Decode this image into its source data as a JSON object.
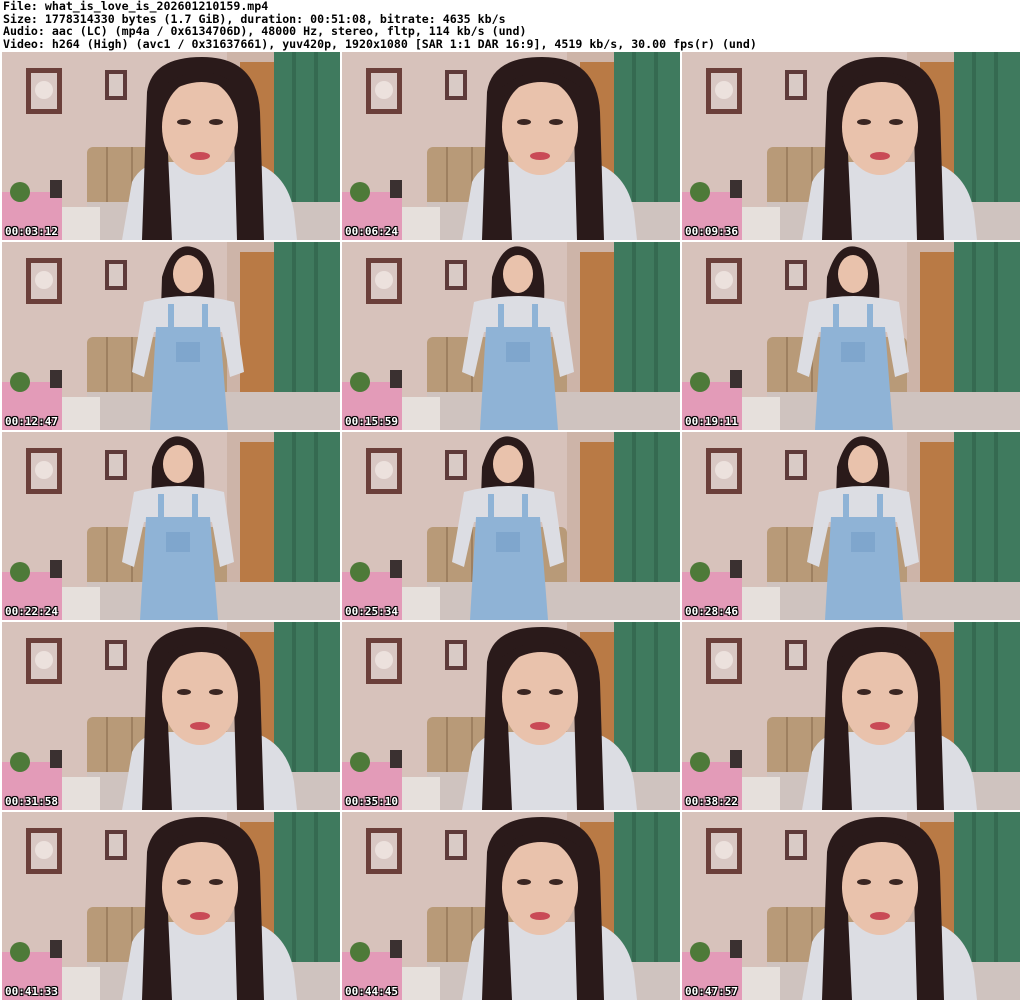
{
  "file_info": {
    "file": "File: what_is_love_is_202601210159.mp4",
    "size": "Size: 1778314330 bytes (1.7 GiB), duration: 00:51:08, bitrate: 4635 kb/s",
    "audio": "Audio: aac (LC) (mp4a / 0x6134706D), 48000 Hz, stereo, fltp, 114 kb/s (und)",
    "video": "Video: h264 (High) (avc1 / 0x31637661), yuv420p, 1920x1080 [SAR 1:1 DAR 16:9], 4519 kb/s, 30.00 fps(r) (und)"
  },
  "thumbnails": [
    {
      "timestamp": "00:03:12",
      "shot": "closeup"
    },
    {
      "timestamp": "00:06:24",
      "shot": "closeup"
    },
    {
      "timestamp": "00:09:36",
      "shot": "closeup"
    },
    {
      "timestamp": "00:12:47",
      "shot": "standing"
    },
    {
      "timestamp": "00:15:59",
      "shot": "standing"
    },
    {
      "timestamp": "00:19:11",
      "shot": "standing"
    },
    {
      "timestamp": "00:22:24",
      "shot": "standing"
    },
    {
      "timestamp": "00:25:34",
      "shot": "standing"
    },
    {
      "timestamp": "00:28:46",
      "shot": "standing"
    },
    {
      "timestamp": "00:31:58",
      "shot": "closeup"
    },
    {
      "timestamp": "00:35:10",
      "shot": "closeup"
    },
    {
      "timestamp": "00:38:22",
      "shot": "closeup"
    },
    {
      "timestamp": "00:41:33",
      "shot": "closeup"
    },
    {
      "timestamp": "00:44:45",
      "shot": "closeup"
    },
    {
      "timestamp": "00:47:57",
      "shot": "closeup"
    }
  ],
  "colors": {
    "wall": "#d7c2bb",
    "curtain_green": "#3f7a5e",
    "curtain_orange": "#b97a45",
    "headboard": "#b89a78",
    "pink_cloth": "#e39bb8",
    "hair": "#2a1a1a",
    "skin": "#e9c2ac",
    "shirt": "#dcdde3",
    "denim": "#8fb3d6",
    "frame": "#6b3f3a"
  }
}
